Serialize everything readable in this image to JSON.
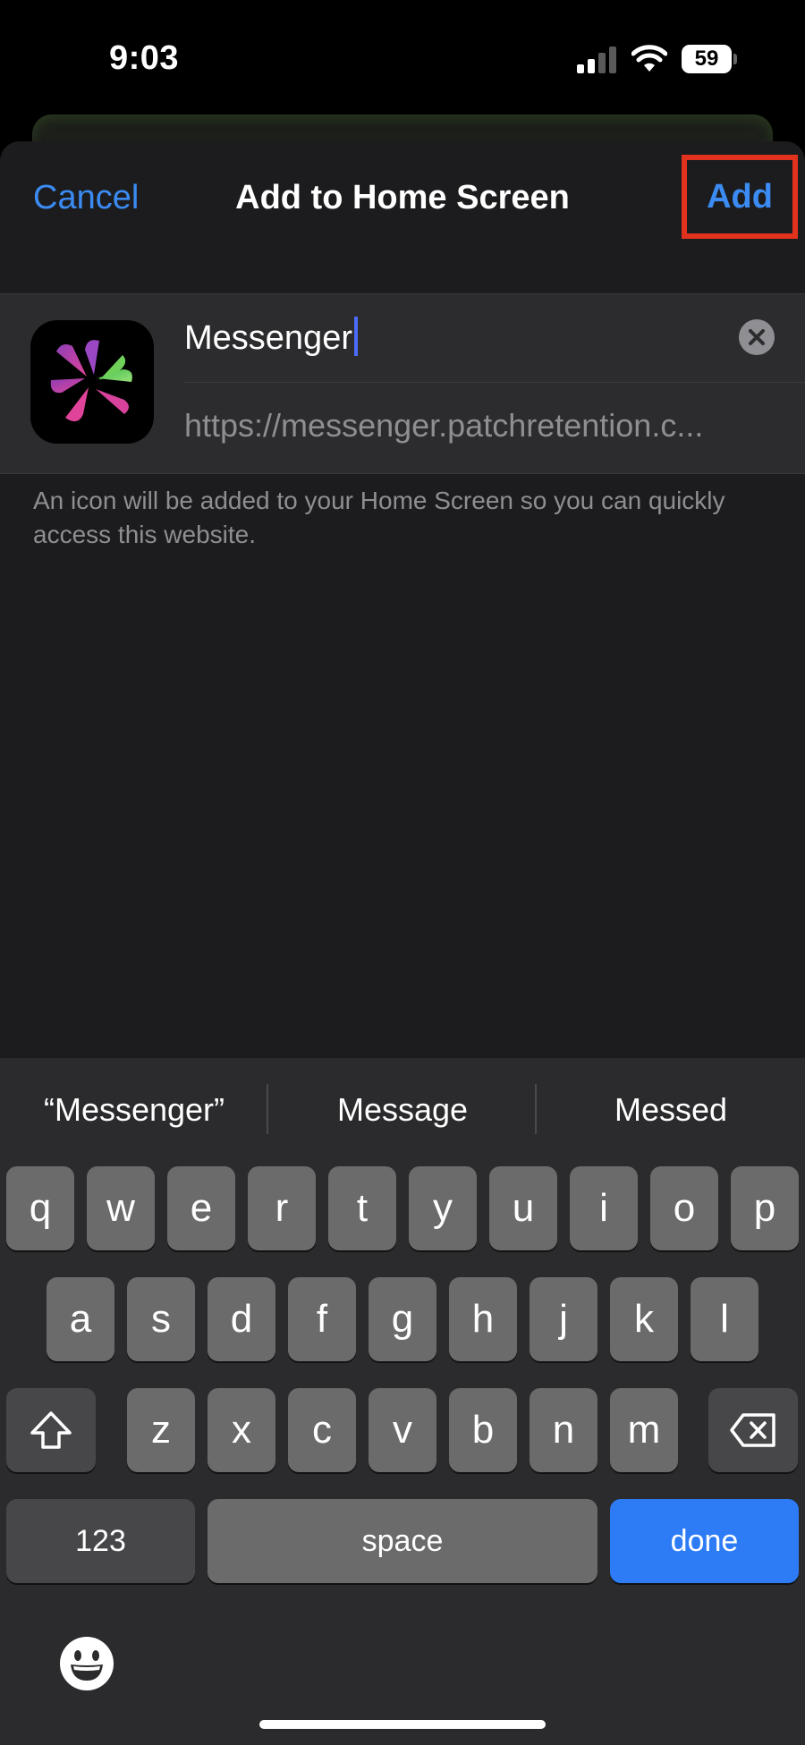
{
  "status_bar": {
    "time": "9:03",
    "battery": "59"
  },
  "sheet": {
    "cancel_label": "Cancel",
    "title": "Add to Home Screen",
    "add_label": "Add"
  },
  "form": {
    "name_value": "Messenger",
    "url_value": "https://messenger.patchretention.c...",
    "footnote": "An icon will be added to your Home Screen so you can quickly access this website."
  },
  "keyboard": {
    "suggestions": [
      "“Messenger”",
      "Message",
      "Messed"
    ],
    "row1": [
      "q",
      "w",
      "e",
      "r",
      "t",
      "y",
      "u",
      "i",
      "o",
      "p"
    ],
    "row2": [
      "a",
      "s",
      "d",
      "f",
      "g",
      "h",
      "j",
      "k",
      "l"
    ],
    "row3": [
      "z",
      "x",
      "c",
      "v",
      "b",
      "n",
      "m"
    ],
    "numbers_label": "123",
    "space_label": "space",
    "done_label": "done"
  },
  "colors": {
    "accent": "#3b8bf2",
    "highlight_box": "#e2321d",
    "done_key": "#2d7cf6"
  }
}
